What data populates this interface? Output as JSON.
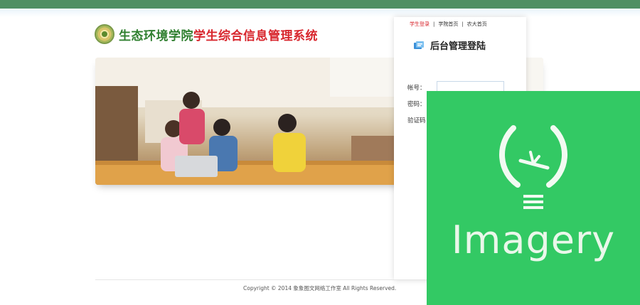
{
  "header": {
    "site_title_green": "生态环境学院",
    "site_title_red": "学生综合信息管理系统"
  },
  "login": {
    "links": [
      "学生登录",
      "学院首页",
      "农大首页"
    ],
    "title": "后台管理登陆",
    "account_label": "帐号：",
    "password_label": "密码：",
    "captcha_label": "验证码"
  },
  "footer": {
    "copyright": "Copyright © 2014 象象图文网络工作室 All Rights Reserved."
  },
  "overlay": {
    "word": "Imagery",
    "icon": "lightbulb-icon"
  },
  "colors": {
    "top_bar": "#4f8f63",
    "title_green": "#2f7f2f",
    "title_red": "#d8262d",
    "overlay_green": "#33c964"
  }
}
